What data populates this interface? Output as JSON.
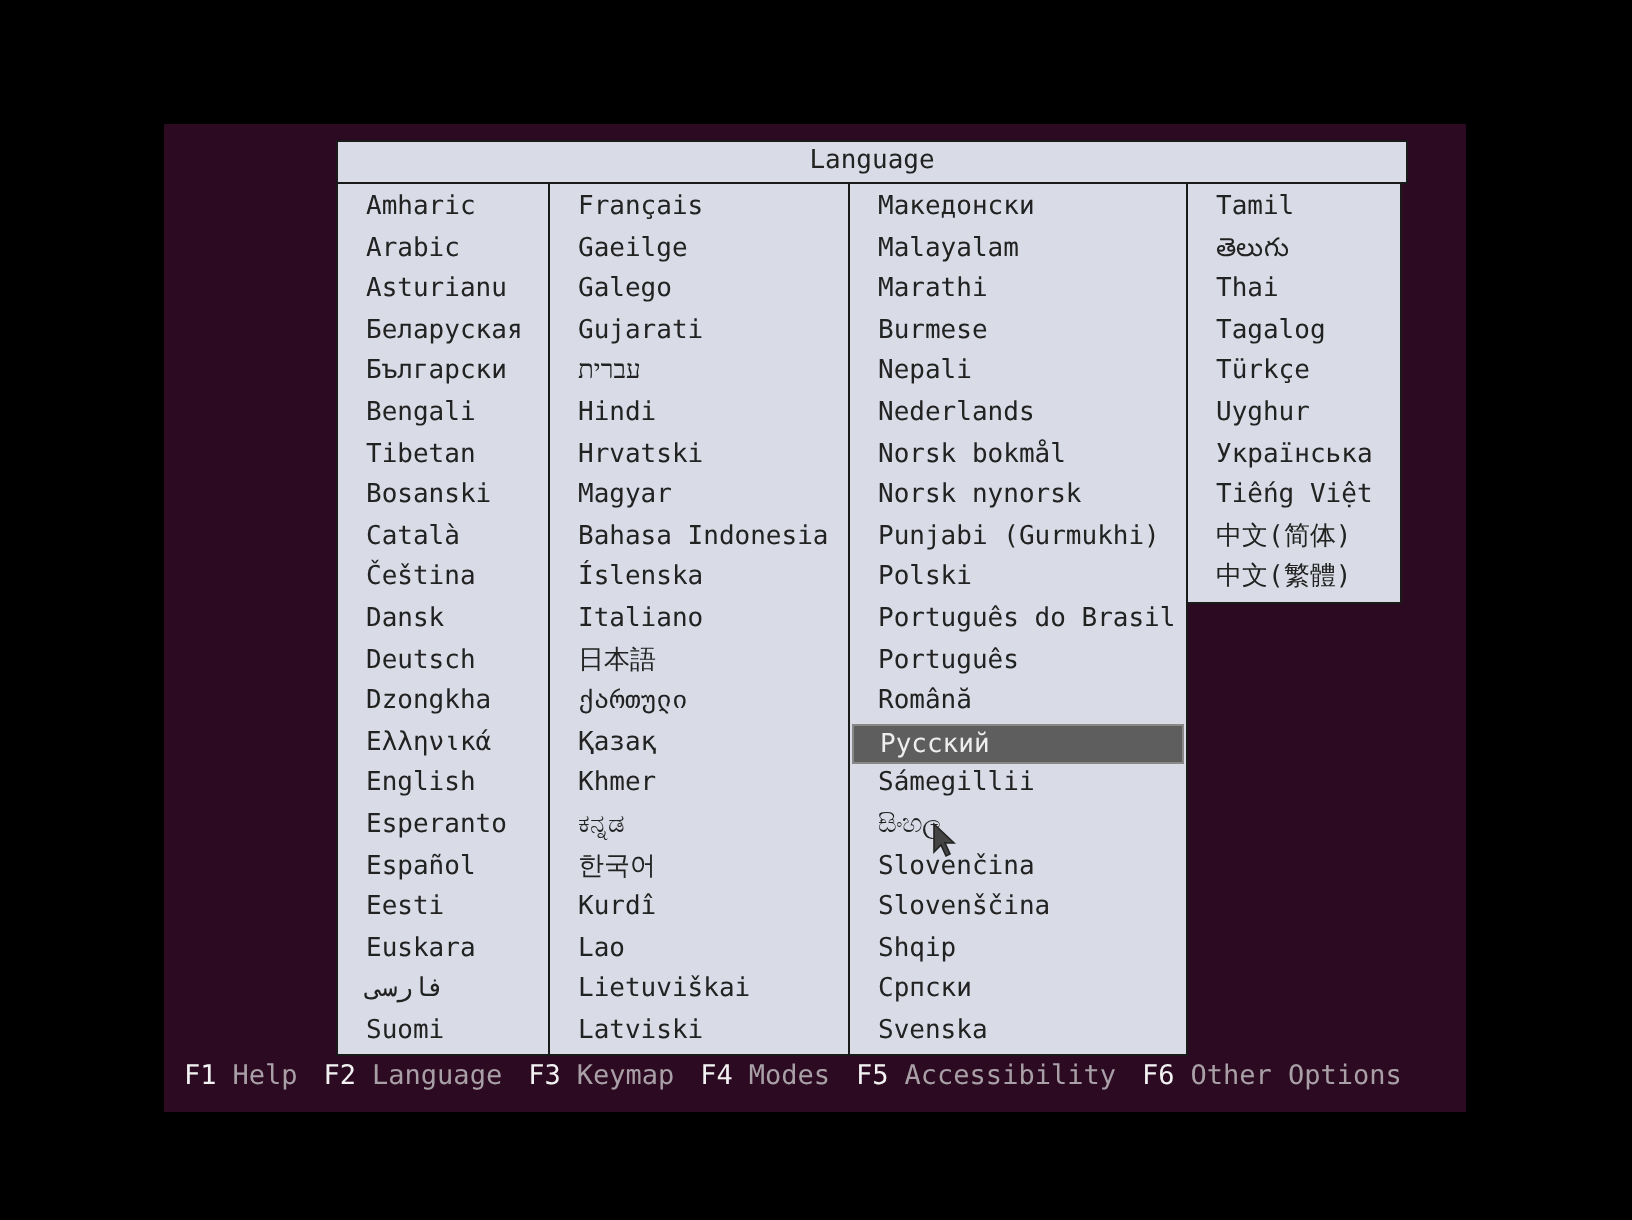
{
  "menu": {
    "title": "Language",
    "columns": [
      {
        "items": [
          {
            "label": "Amharic",
            "selected": false
          },
          {
            "label": "Arabic",
            "selected": false
          },
          {
            "label": "Asturianu",
            "selected": false
          },
          {
            "label": "Беларуская",
            "selected": false
          },
          {
            "label": "Български",
            "selected": false
          },
          {
            "label": "Bengali",
            "selected": false
          },
          {
            "label": "Tibetan",
            "selected": false
          },
          {
            "label": "Bosanski",
            "selected": false
          },
          {
            "label": "Català",
            "selected": false
          },
          {
            "label": "Čeština",
            "selected": false
          },
          {
            "label": "Dansk",
            "selected": false
          },
          {
            "label": "Deutsch",
            "selected": false
          },
          {
            "label": "Dzongkha",
            "selected": false
          },
          {
            "label": "Ελληνικά",
            "selected": false
          },
          {
            "label": "English",
            "selected": false
          },
          {
            "label": "Esperanto",
            "selected": false
          },
          {
            "label": "Español",
            "selected": false
          },
          {
            "label": "Eesti",
            "selected": false
          },
          {
            "label": "Euskara",
            "selected": false
          },
          {
            "label": "فارسی",
            "selected": false
          },
          {
            "label": "Suomi",
            "selected": false
          }
        ]
      },
      {
        "items": [
          {
            "label": "Français",
            "selected": false
          },
          {
            "label": "Gaeilge",
            "selected": false
          },
          {
            "label": "Galego",
            "selected": false
          },
          {
            "label": "Gujarati",
            "selected": false
          },
          {
            "label": "עברית",
            "selected": false
          },
          {
            "label": "Hindi",
            "selected": false
          },
          {
            "label": "Hrvatski",
            "selected": false
          },
          {
            "label": "Magyar",
            "selected": false
          },
          {
            "label": "Bahasa Indonesia",
            "selected": false
          },
          {
            "label": "Íslenska",
            "selected": false
          },
          {
            "label": "Italiano",
            "selected": false
          },
          {
            "label": "日本語",
            "selected": false
          },
          {
            "label": "ქართული",
            "selected": false
          },
          {
            "label": "Қазақ",
            "selected": false
          },
          {
            "label": "Khmer",
            "selected": false
          },
          {
            "label": "ಕನ್ನಡ",
            "selected": false
          },
          {
            "label": "한국어",
            "selected": false
          },
          {
            "label": "Kurdî",
            "selected": false
          },
          {
            "label": "Lao",
            "selected": false
          },
          {
            "label": "Lietuviškai",
            "selected": false
          },
          {
            "label": "Latviski",
            "selected": false
          }
        ]
      },
      {
        "items": [
          {
            "label": "Македонски",
            "selected": false
          },
          {
            "label": "Malayalam",
            "selected": false
          },
          {
            "label": "Marathi",
            "selected": false
          },
          {
            "label": "Burmese",
            "selected": false
          },
          {
            "label": "Nepali",
            "selected": false
          },
          {
            "label": "Nederlands",
            "selected": false
          },
          {
            "label": "Norsk bokmål",
            "selected": false
          },
          {
            "label": "Norsk nynorsk",
            "selected": false
          },
          {
            "label": "Punjabi (Gurmukhi)",
            "selected": false
          },
          {
            "label": "Polski",
            "selected": false
          },
          {
            "label": "Português do Brasil",
            "selected": false
          },
          {
            "label": "Português",
            "selected": false
          },
          {
            "label": "Română",
            "selected": false
          },
          {
            "label": "Русский",
            "selected": true
          },
          {
            "label": "Sámegillii",
            "selected": false
          },
          {
            "label": "සිංහල",
            "selected": false
          },
          {
            "label": "Slovenčina",
            "selected": false
          },
          {
            "label": "Slovenščina",
            "selected": false
          },
          {
            "label": "Shqip",
            "selected": false
          },
          {
            "label": "Српски",
            "selected": false
          },
          {
            "label": "Svenska",
            "selected": false
          }
        ]
      },
      {
        "items": [
          {
            "label": "Tamil",
            "selected": false
          },
          {
            "label": "తెలుగు",
            "selected": false
          },
          {
            "label": "Thai",
            "selected": false
          },
          {
            "label": "Tagalog",
            "selected": false
          },
          {
            "label": "Türkçe",
            "selected": false
          },
          {
            "label": "Uyghur",
            "selected": false
          },
          {
            "label": "Українська",
            "selected": false
          },
          {
            "label": "Tiếng Việt",
            "selected": false
          },
          {
            "label": "中文(简体)",
            "selected": false
          },
          {
            "label": "中文(繁體)",
            "selected": false
          }
        ]
      }
    ]
  },
  "function_keys": [
    {
      "key": "F1",
      "label": "Help"
    },
    {
      "key": "F2",
      "label": "Language"
    },
    {
      "key": "F3",
      "label": "Keymap"
    },
    {
      "key": "F4",
      "label": "Modes"
    },
    {
      "key": "F5",
      "label": "Accessibility"
    },
    {
      "key": "F6",
      "label": "Other Options"
    }
  ]
}
